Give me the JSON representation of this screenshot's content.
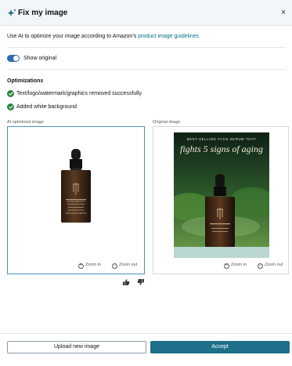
{
  "header": {
    "title": "Fix my image",
    "close_label": "×"
  },
  "intro": {
    "text": "Use AI to optimize your image according to Amazon’s ",
    "link": "product image guidelines"
  },
  "toggle": {
    "label": "Show original",
    "on": true
  },
  "optimizations": {
    "title": "Optimizations",
    "items": [
      "Text/logo/watermark/graphics removed successfully.",
      "Added white background"
    ]
  },
  "panels": {
    "ai": {
      "label": "AI optimized image",
      "zoom_in": "Zoom in",
      "zoom_out": "Zoom out"
    },
    "original": {
      "label": "Original image",
      "banner_small": "BEST-SELLING FACE SERUM THAT",
      "banner_large": "fights 5 signs of aging",
      "zoom_in": "Zoom in",
      "zoom_out": "Zoom out"
    }
  },
  "bottle_label": {
    "brand": "TRAVEL PRODUCT",
    "line1": "MULTIPLE ACTIVE",
    "line2": "RESTORATIVE SERUM"
  },
  "footer": {
    "upload_label": "Upload new image",
    "accept_label": "Accept"
  },
  "colors": {
    "accent": "#1f6f8b",
    "check": "#2e8540",
    "link": "#007185",
    "toggle": "#2b6cb0"
  }
}
